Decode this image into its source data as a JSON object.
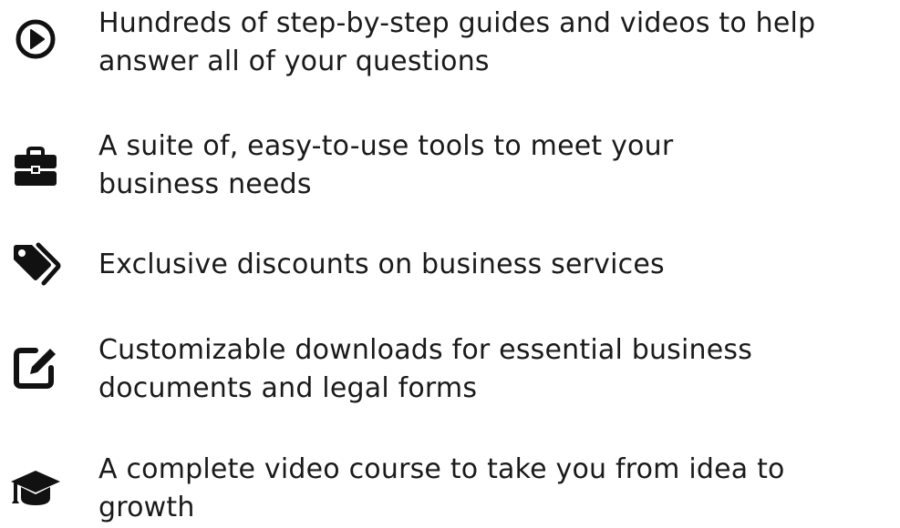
{
  "features": [
    {
      "icon": "play-circle-icon",
      "text": "Hundreds of step-by-step guides and videos to help answer all of your questions"
    },
    {
      "icon": "briefcase-icon",
      "text": "A suite of, easy-to-use tools to meet your business needs"
    },
    {
      "icon": "tags-icon",
      "text": "Exclusive discounts on business services"
    },
    {
      "icon": "edit-icon",
      "text": "Customizable downloads for essential business documents and legal forms"
    },
    {
      "icon": "graduation-cap-icon",
      "text": "A complete video course to take you from idea to growth"
    }
  ],
  "colors": {
    "icon": "#111111",
    "text": "#1a1a1a",
    "background": "#ffffff"
  }
}
